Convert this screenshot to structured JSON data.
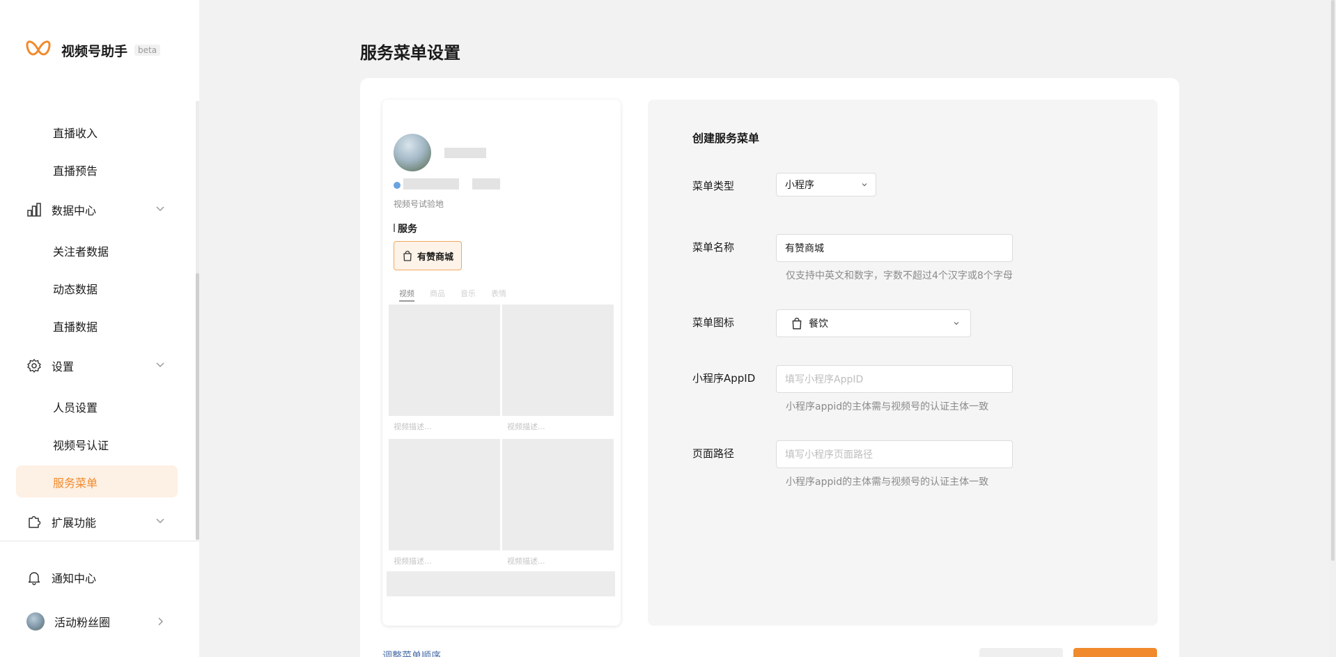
{
  "app": {
    "name": "视频号助手",
    "badge": "beta",
    "accent_color": "#f08a2c"
  },
  "sidebar": {
    "items": [
      {
        "label": "直播收入",
        "type": "sub"
      },
      {
        "label": "直播预告",
        "type": "sub"
      },
      {
        "label": "数据中心",
        "type": "group",
        "icon": "bar-chart-icon"
      },
      {
        "label": "关注者数据",
        "type": "sub"
      },
      {
        "label": "动态数据",
        "type": "sub"
      },
      {
        "label": "直播数据",
        "type": "sub"
      },
      {
        "label": "设置",
        "type": "group",
        "icon": "gear-icon"
      },
      {
        "label": "人员设置",
        "type": "sub"
      },
      {
        "label": "视频号认证",
        "type": "sub"
      },
      {
        "label": "服务菜单",
        "type": "sub",
        "active": true
      },
      {
        "label": "扩展功能",
        "type": "group",
        "icon": "puzzle-icon"
      }
    ],
    "bottom": {
      "notifications": "通知中心",
      "account": "活动粉丝圈"
    }
  },
  "page": {
    "title": "服务菜单设置"
  },
  "preview": {
    "subtitle": "视频号试验地",
    "section": "服务",
    "menu_button": "有赞商城",
    "tabs": [
      "视频",
      "商品",
      "音乐",
      "表情"
    ],
    "video_caption": "视频描述..."
  },
  "form": {
    "title": "创建服务菜单",
    "menu_type": {
      "label": "菜单类型",
      "value": "小程序"
    },
    "menu_name": {
      "label": "菜单名称",
      "value": "有赞商城",
      "help": "仅支持中英文和数字，字数不超过4个汉字或8个字母"
    },
    "menu_icon": {
      "label": "菜单图标",
      "value": "餐饮"
    },
    "appid": {
      "label": "小程序AppID",
      "placeholder": "填写小程序AppID",
      "help": "小程序appid的主体需与视频号的认证主体一致"
    },
    "path": {
      "label": "页面路径",
      "placeholder": "填写小程序页面路径",
      "help": "小程序appid的主体需与视频号的认证主体一致"
    }
  },
  "footer": {
    "reorder_link": "调整菜单顺序"
  }
}
